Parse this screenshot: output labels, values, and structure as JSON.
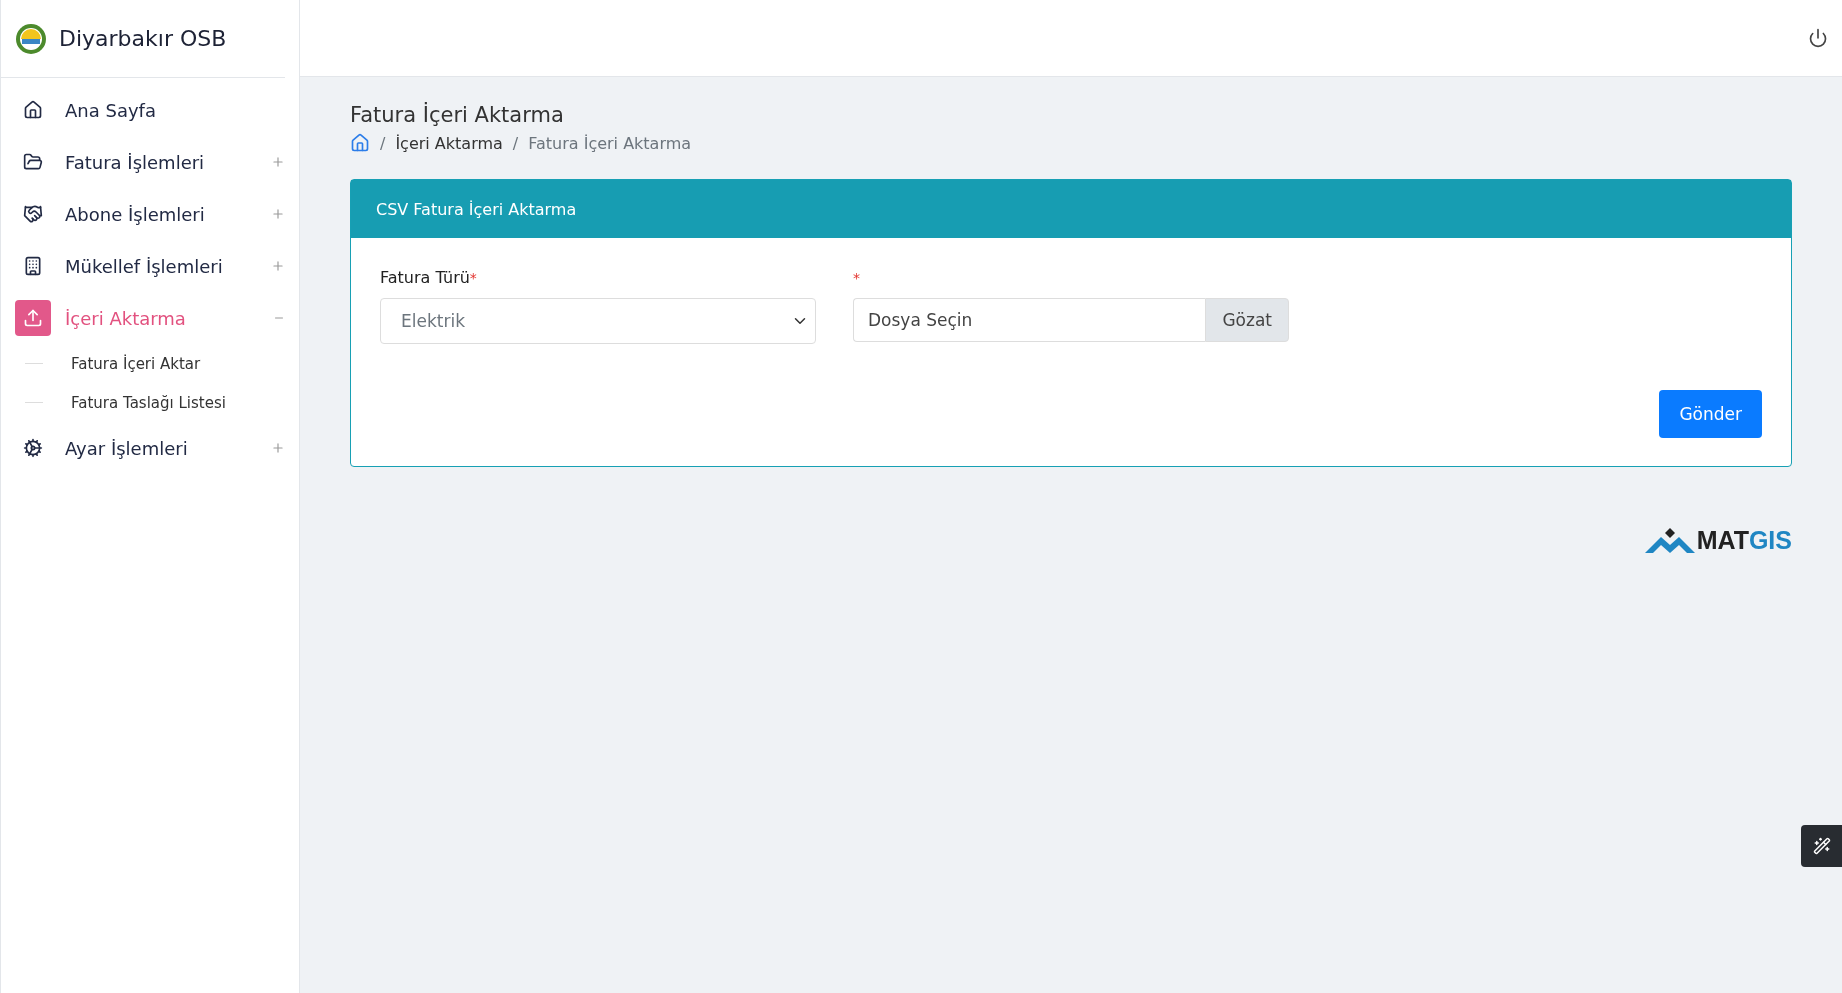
{
  "brand": {
    "title": "Diyarbakır OSB"
  },
  "sidebar": {
    "items": [
      {
        "label": "Ana Sayfa",
        "kind": "link",
        "selected": false
      },
      {
        "label": "Fatura İşlemleri",
        "kind": "group",
        "selected": false,
        "expanded": false
      },
      {
        "label": "Abone İşlemleri",
        "kind": "group",
        "selected": false,
        "expanded": false
      },
      {
        "label": "Mükellef İşlemleri",
        "kind": "group",
        "selected": false,
        "expanded": false
      },
      {
        "label": "İçeri Aktarma",
        "kind": "group",
        "selected": true,
        "expanded": true,
        "children": [
          {
            "label": "Fatura İçeri Aktar",
            "selected": false
          },
          {
            "label": "Fatura Taslağı Listesi",
            "selected": false
          }
        ]
      },
      {
        "label": "Ayar İşlemleri",
        "kind": "group",
        "selected": false,
        "expanded": false
      }
    ]
  },
  "page": {
    "title": "Fatura İçeri Aktarma",
    "separator": "/",
    "breadcrumb": [
      {
        "label": "İçeri Aktarma",
        "current": false
      },
      {
        "label": "Fatura İçeri Aktarma",
        "current": true
      }
    ]
  },
  "card": {
    "title": "CSV Fatura İçeri Aktarma",
    "fields": [
      {
        "kind": "select",
        "label": "Fatura Türü",
        "required_mark": "*",
        "value": "Elektrik"
      },
      {
        "kind": "file",
        "required_mark": "*",
        "placeholder": "Dosya Seçin",
        "browse": "Gözat"
      }
    ],
    "submit": "Gönder"
  },
  "footer_logo": {
    "dark": "MAT",
    "accent": "GIS"
  }
}
